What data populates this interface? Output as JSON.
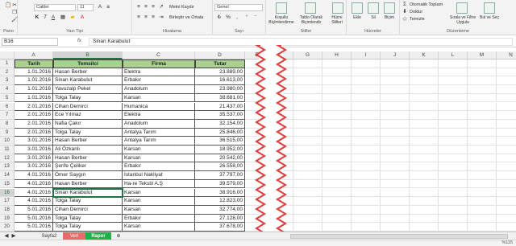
{
  "ribbon": {
    "font_name": "Calibri",
    "font_size": "11",
    "number_format": "Genel",
    "wrap_text": "Metni Kaydır",
    "merge_center": "Birleştir ve Ortala",
    "cond_format": "Koşullu Biçimlendirme",
    "format_table": "Tablo Olarak Biçimlendir",
    "cell_styles": "Hücre Stilleri",
    "insert": "Ekle",
    "delete": "Sil",
    "format": "Biçim",
    "autosum": "Otomatik Toplam",
    "fill": "Doldur",
    "clear": "Temizle",
    "sort_filter": "Sırala ve Filtre Uygula",
    "find_select": "Bul ve Seç",
    "groups": {
      "clipboard": "Pano",
      "font": "Yazı Tipi",
      "alignment": "Hizalama",
      "number": "Sayı",
      "styles": "Stiller",
      "cells": "Hücreler",
      "editing": "Düzenleme"
    }
  },
  "formula_bar": {
    "name_box": "B16",
    "fx": "fx",
    "content": "Sinan Karabulut"
  },
  "columns": [
    "A",
    "B",
    "C",
    "D",
    "E",
    "F",
    "G",
    "H",
    "I",
    "J",
    "K",
    "L",
    "M",
    "N"
  ],
  "table": {
    "headers": [
      "Tarih",
      "Temsilci",
      "Firma",
      "Tutar"
    ],
    "rows": [
      [
        "1.01.2016",
        "Hasan Berber",
        "Elektra",
        "23.889,00"
      ],
      [
        "1.01.2016",
        "Sinan Karabulut",
        "Erbakır",
        "16.613,00"
      ],
      [
        "1.01.2016",
        "Yavuzalp Pekel",
        "Anadolum",
        "23.980,00"
      ],
      [
        "1.01.2016",
        "Tolga Talay",
        "Karsan",
        "38.681,00"
      ],
      [
        "2.01.2016",
        "Cihan Demirci",
        "Humanica",
        "21.437,00"
      ],
      [
        "2.01.2016",
        "Ece Yılmaz",
        "Elektra",
        "35.537,00"
      ],
      [
        "2.01.2016",
        "Nafia Çakır",
        "Anadolum",
        "32.154,00"
      ],
      [
        "2.01.2016",
        "Tolga Talay",
        "Antalya Tarım",
        "25.846,00"
      ],
      [
        "3.01.2016",
        "Hasan Berber",
        "Antalya Tarım",
        "36.515,00"
      ],
      [
        "3.01.2016",
        "Ali Özkanlı",
        "Karsan",
        "18.952,00"
      ],
      [
        "3.01.2016",
        "Hasan Berber",
        "Karsan",
        "20.542,00"
      ],
      [
        "3.01.2016",
        "Şerife Çeliker",
        "Erbakır",
        "26.558,00"
      ],
      [
        "4.01.2016",
        "Ömer Saygın",
        "İstanbul Nakliyat",
        "37.797,00"
      ],
      [
        "4.01.2016",
        "Hasan Berber",
        "Ha-re Tekstil A.Ş",
        "39.579,00"
      ],
      [
        "4.01.2016",
        "Sinan Karabulut",
        "Karsan",
        "38.916,00"
      ],
      [
        "4.01.2016",
        "Tolga Talay",
        "Karsan",
        "12.823,00"
      ],
      [
        "5.01.2016",
        "Cihan Demirci",
        "Karsan",
        "32.774,00"
      ],
      [
        "5.01.2016",
        "Tolga Talay",
        "Erbakır",
        "27.128,00"
      ],
      [
        "5.01.2016",
        "Tolga Talay",
        "Karsan",
        "37.678,00"
      ]
    ]
  },
  "sheet_tabs": [
    "Sayfa2",
    "Veri",
    "Rapor"
  ],
  "add_sheet": "⊕",
  "status_zoom": "%115",
  "colors": {
    "accent": "#217346",
    "header_fill": "#a9d08e",
    "tab_red": "#e86a6a",
    "tab_green": "#19b34a",
    "zigzag": "#e33b3b"
  }
}
